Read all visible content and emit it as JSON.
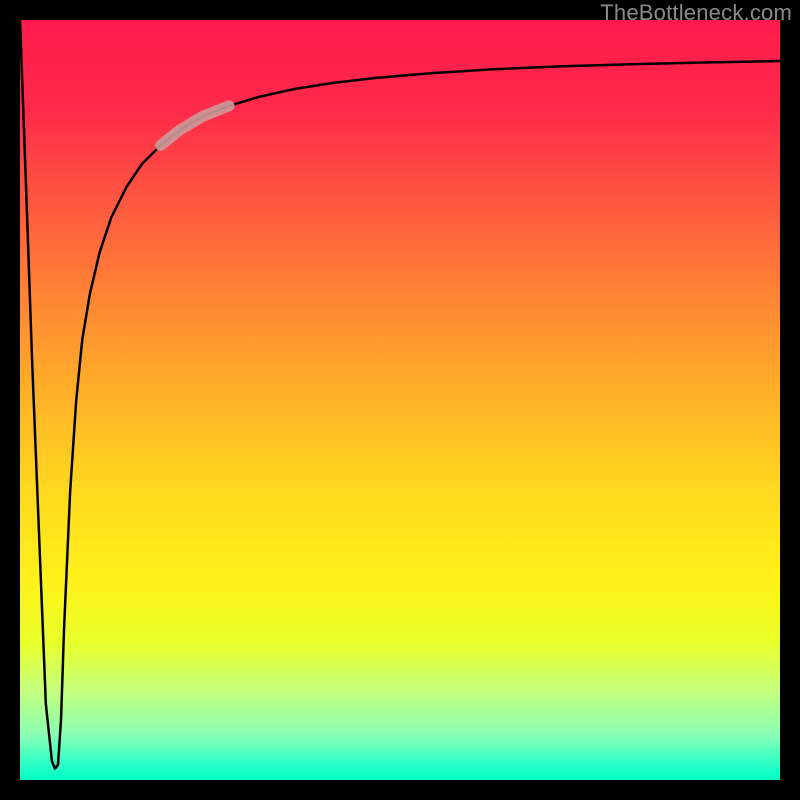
{
  "watermark": "TheBottleneck.com",
  "chart_data": {
    "type": "line",
    "title": "",
    "xlabel": "",
    "ylabel": "",
    "xlim": [
      0,
      100
    ],
    "ylim": [
      0,
      100
    ],
    "grid": false,
    "legend": false,
    "series": [
      {
        "name": "bottleneck-curve",
        "x": [
          0.0,
          0.8,
          1.6,
          2.6,
          3.4,
          4.2,
          4.6,
          5.0,
          5.4,
          5.8,
          6.6,
          7.4,
          8.2,
          9.2,
          10.5,
          12.0,
          14.0,
          16.0,
          18.5,
          21.0,
          24.0,
          27.5,
          31.5,
          36.0,
          41.0,
          47.0,
          54.0,
          62.0,
          71.0,
          81.0,
          90.0,
          100.0
        ],
        "y": [
          100.0,
          78.0,
          55.0,
          30.0,
          10.0,
          2.5,
          1.5,
          2.0,
          8.0,
          20.0,
          38.0,
          50.0,
          58.0,
          64.0,
          69.5,
          74.0,
          78.0,
          81.0,
          83.5,
          85.5,
          87.3,
          88.7,
          89.9,
          90.9,
          91.7,
          92.4,
          93.0,
          93.5,
          93.9,
          94.2,
          94.4,
          94.6
        ]
      },
      {
        "name": "highlight-segment",
        "x": [
          18.5,
          21.0,
          24.0,
          27.5
        ],
        "y": [
          83.5,
          85.5,
          87.3,
          88.7
        ]
      }
    ],
    "colors": {
      "curve": "#000000",
      "highlight": "#cc9a9a"
    },
    "annotations": []
  }
}
